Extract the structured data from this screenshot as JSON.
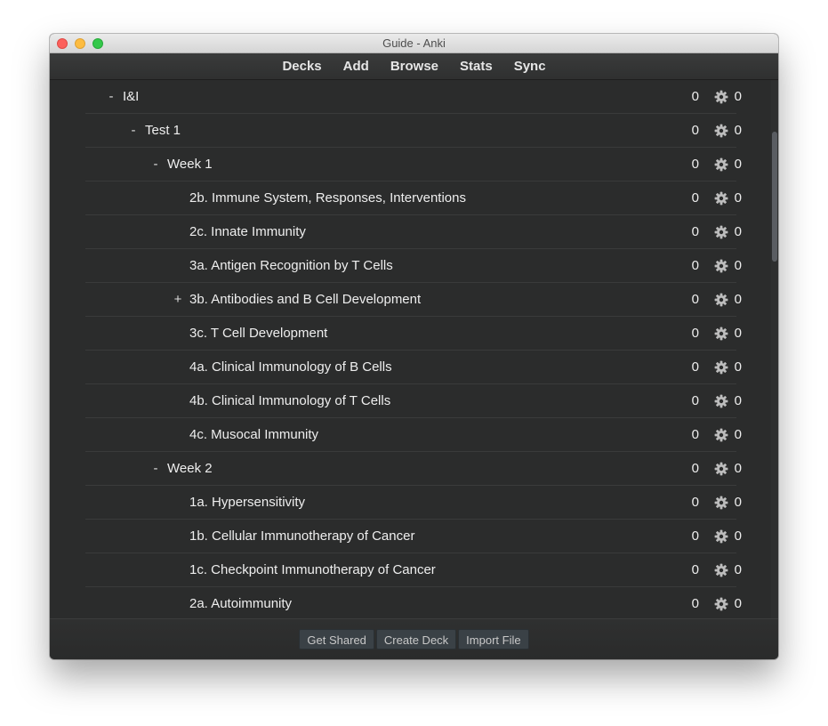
{
  "window": {
    "title": "Guide - Anki"
  },
  "toolbar": {
    "items": [
      "Decks",
      "Add",
      "Browse",
      "Stats",
      "Sync"
    ]
  },
  "decks": [
    {
      "toggle": "-",
      "name": "I&I",
      "depth": 0,
      "due": "0",
      "new": "0"
    },
    {
      "toggle": "-",
      "name": "Test 1",
      "depth": 1,
      "due": "0",
      "new": "0"
    },
    {
      "toggle": "-",
      "name": "Week 1",
      "depth": 2,
      "due": "0",
      "new": "0"
    },
    {
      "toggle": "",
      "name": "2b. Immune System, Responses, Interventions",
      "depth": 3,
      "due": "0",
      "new": "0"
    },
    {
      "toggle": "",
      "name": "2c. Innate Immunity",
      "depth": 3,
      "due": "0",
      "new": "0"
    },
    {
      "toggle": "",
      "name": "3a. Antigen Recognition by T Cells",
      "depth": 3,
      "due": "0",
      "new": "0"
    },
    {
      "toggle": "+",
      "name": "3b. Antibodies and B Cell Development",
      "depth": 3,
      "due": "0",
      "new": "0"
    },
    {
      "toggle": "",
      "name": "3c. T Cell Development",
      "depth": 3,
      "due": "0",
      "new": "0"
    },
    {
      "toggle": "",
      "name": "4a. Clinical Immunology of B Cells",
      "depth": 3,
      "due": "0",
      "new": "0"
    },
    {
      "toggle": "",
      "name": "4b. Clinical Immunology of T Cells",
      "depth": 3,
      "due": "0",
      "new": "0"
    },
    {
      "toggle": "",
      "name": "4c. Musocal Immunity",
      "depth": 3,
      "due": "0",
      "new": "0"
    },
    {
      "toggle": "-",
      "name": "Week 2",
      "depth": 2,
      "due": "0",
      "new": "0"
    },
    {
      "toggle": "",
      "name": "1a. Hypersensitivity",
      "depth": 3,
      "due": "0",
      "new": "0"
    },
    {
      "toggle": "",
      "name": "1b. Cellular Immunotherapy of Cancer",
      "depth": 3,
      "due": "0",
      "new": "0"
    },
    {
      "toggle": "",
      "name": "1c. Checkpoint Immunotherapy of Cancer",
      "depth": 3,
      "due": "0",
      "new": "0"
    },
    {
      "toggle": "",
      "name": "2a. Autoimmunity",
      "depth": 3,
      "due": "0",
      "new": "0"
    }
  ],
  "icons": {
    "gear": "gear-icon"
  },
  "bottombar": {
    "get_shared": "Get Shared",
    "create_deck": "Create Deck",
    "import_file": "Import File"
  },
  "colors": {
    "background": "#2b2c2c",
    "text": "#eeeeee",
    "button": "#3a4146"
  }
}
